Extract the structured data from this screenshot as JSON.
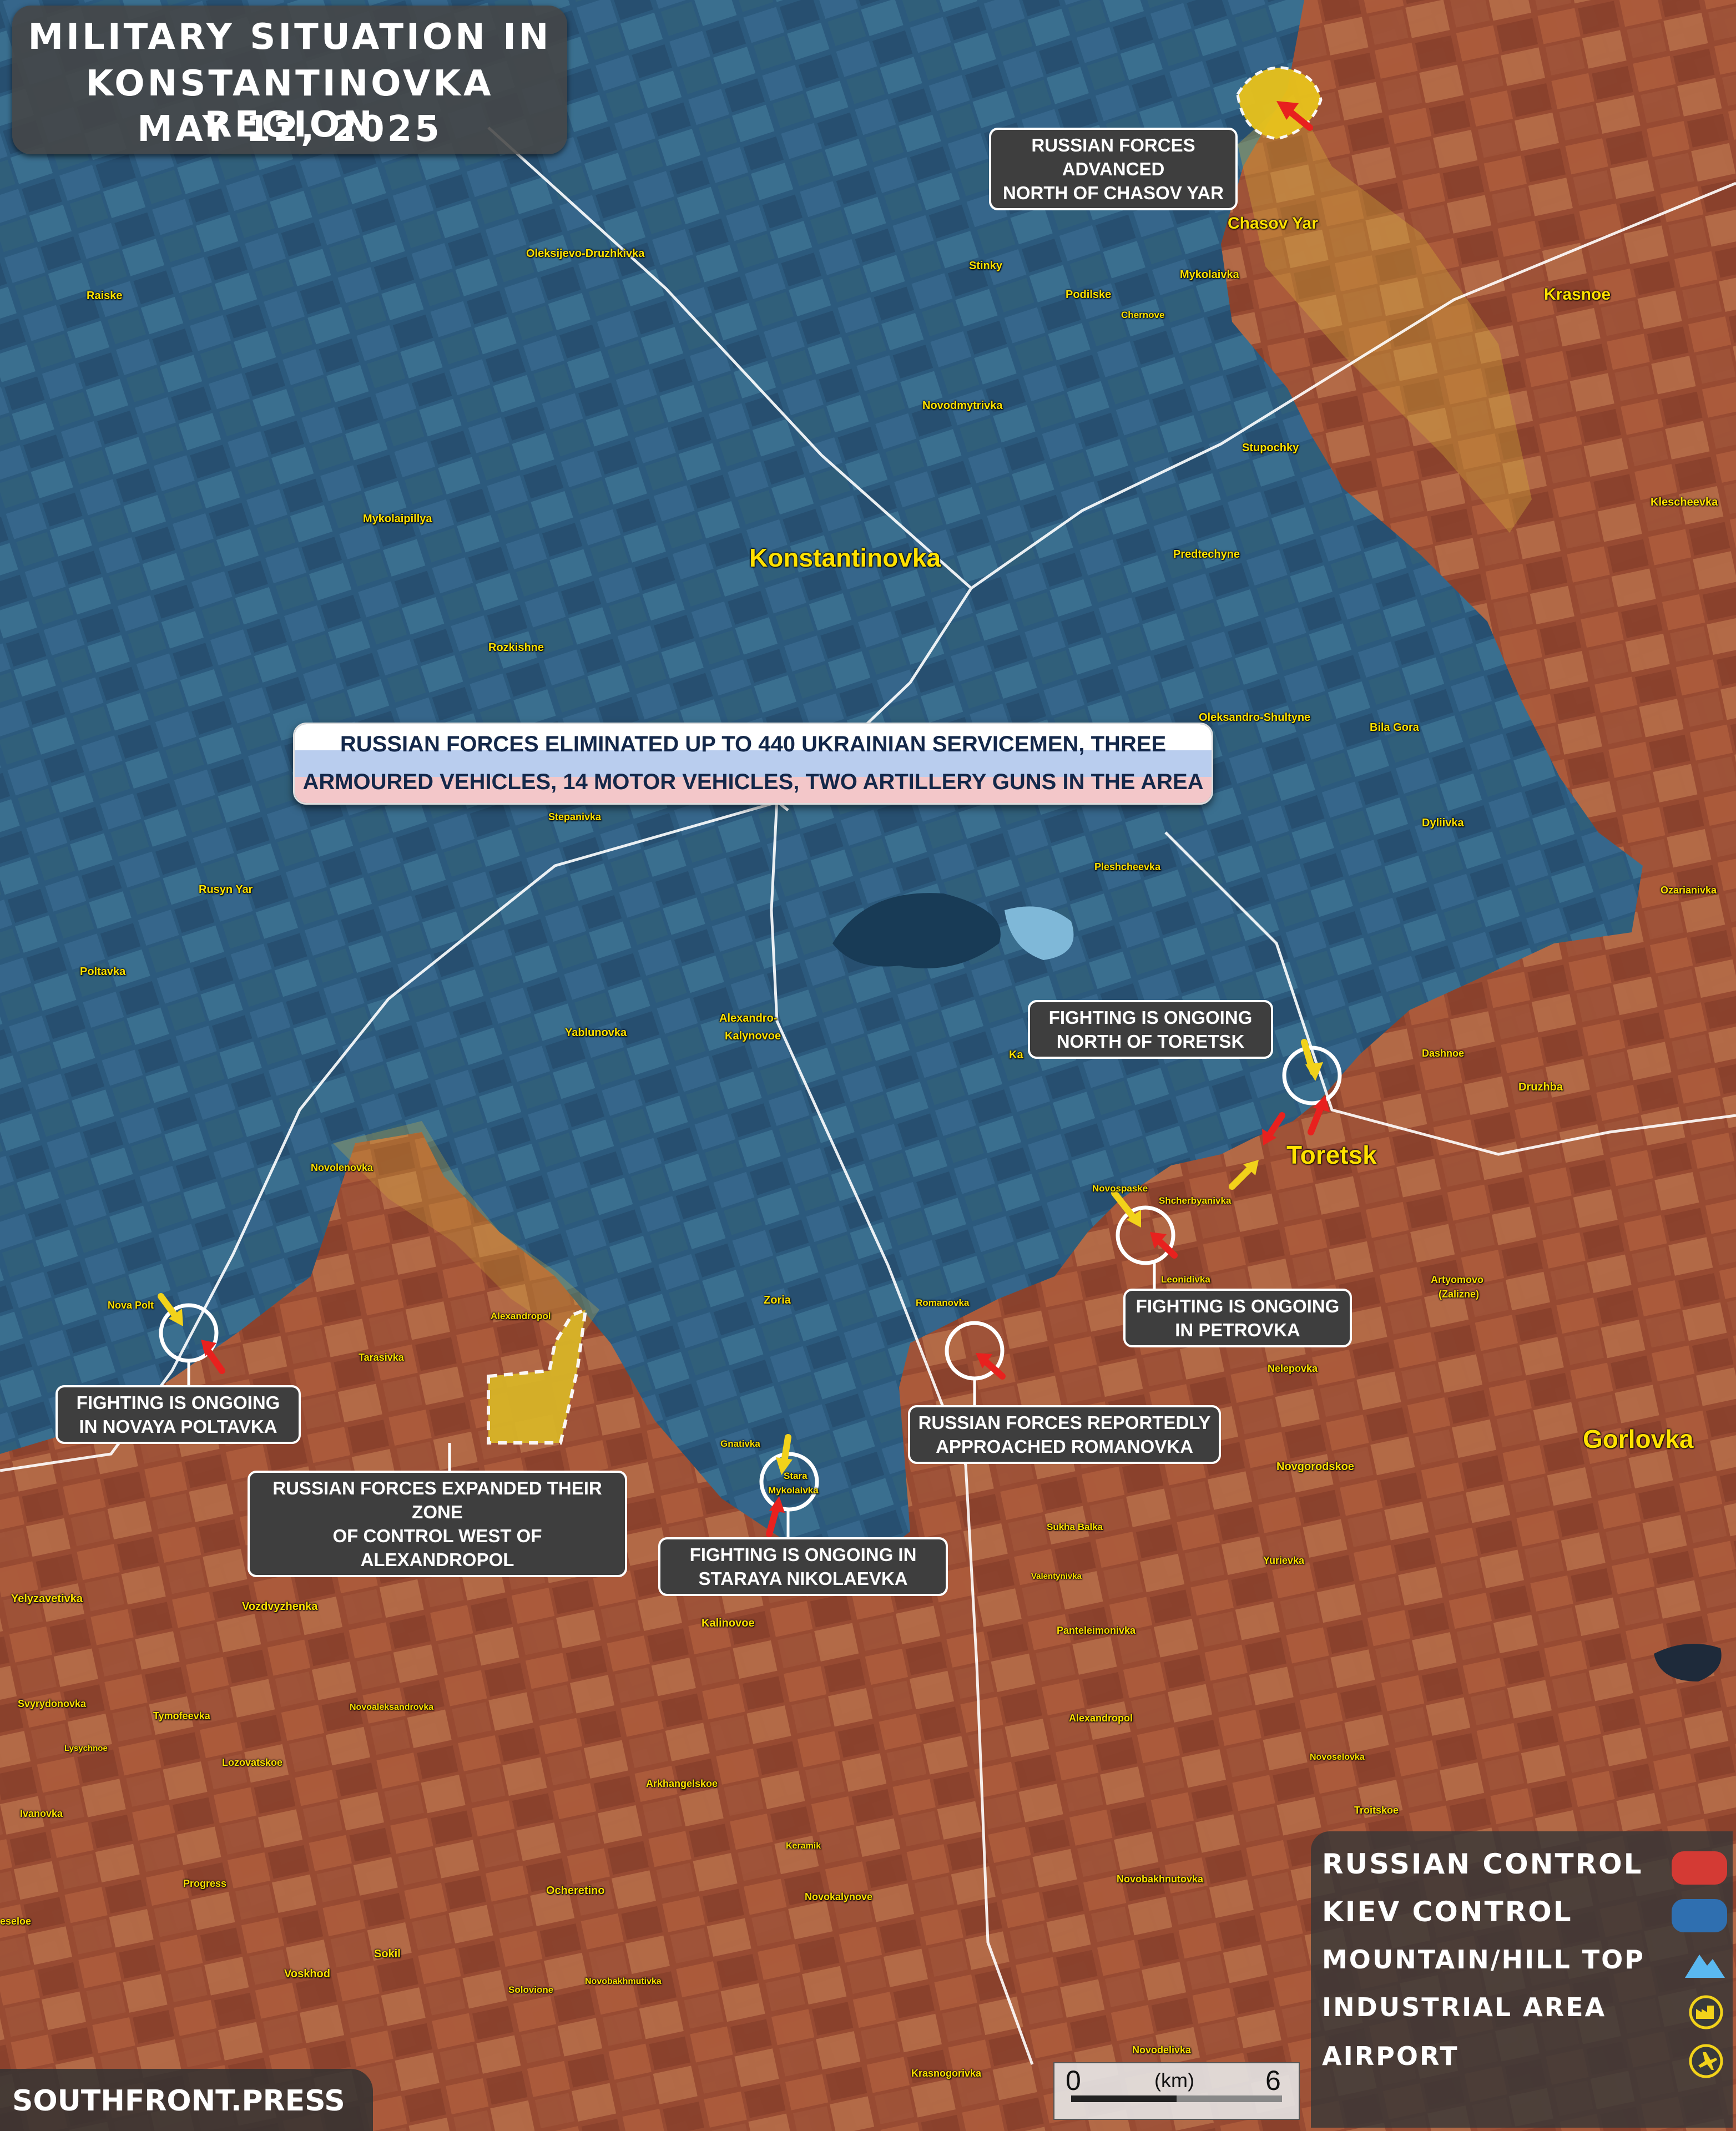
{
  "title": {
    "line1": "MILITARY SITUATION IN",
    "line2": "KONSTANTINOVKA REGION",
    "line3": "MAY 12, 2025"
  },
  "banner": {
    "line1": "RUSSIAN FORCES ELIMINATED UP TO 440 UKRAINIAN SERVICEMEN, THREE",
    "line2": "ARMOURED VEHICLES, 14 MOTOR VEHICLES, TWO ARTILLERY GUNS IN THE AREA"
  },
  "callouts": {
    "chasov_yar": [
      "RUSSIAN FORCES ADVANCED",
      "NORTH OF CHASOV YAR"
    ],
    "north_toretsk": [
      "FIGHTING IS ONGOING",
      "NORTH OF TORETSK"
    ],
    "petrovka": [
      "FIGHTING IS ONGOING",
      "IN PETROVKA"
    ],
    "romanovka": [
      "RUSSIAN FORCES REPORTEDLY",
      "APPROACHED ROMANOVKA"
    ],
    "staraya": [
      "FIGHTING IS ONGOING IN",
      "STARAYA NIKOLAEVKA"
    ],
    "alexandropol": [
      "RUSSIAN FORCES EXPANDED THEIR ZONE",
      "OF CONTROL WEST OF ALEXANDROPOL"
    ],
    "novaya_poltavka": [
      "FIGHTING IS ONGOING",
      "IN NOVAYA POLTAVKA"
    ]
  },
  "places": {
    "konstantinovka": "Konstantinovka",
    "chasov_yar": "Chasov Yar",
    "krasnoe": "Krasnoe",
    "toretsk": "Toretsk",
    "gorlovka": "Gorlovka",
    "oleksijevo": "Oleksijevo-Druzhkivka",
    "raiske": "Raiske",
    "stinky": "Stinky",
    "podilske": "Podilske",
    "mykolaivka": "Mykolaivka",
    "chernove": "Chernove",
    "novodmytrivka": "Novodmytrivka",
    "stupochky": "Stupochky",
    "klescheevka": "Klescheevka",
    "mykolaipillya": "Mykolaipillya",
    "predtechyne": "Predtechyne",
    "rozkishne": "Rozkishne",
    "oleksandro_shultyne": "Oleksandro-Shultyne",
    "bila_gora": "Bila Gora",
    "dyliivka": "Dyliivka",
    "stepanivka": "Stepanivka",
    "rusyn_yar": "Rusyn Yar",
    "pleshcheevka": "Pleshcheevka",
    "ozarianivka": "Ozarianivka",
    "poltavka": "Poltavka",
    "yablunovka": "Yablunovka",
    "alexandro_kalynovoe_1": "Alexandro-",
    "alexandro_kalynovoe_2": "Kalynovoe",
    "ka": "Ka",
    "dashnoe": "Dashnoe",
    "druzhba": "Druzhba",
    "novolenovka": "Novolenovka",
    "novospaske": "Novospaske",
    "shcherbyanivka": "Shcherbyanivka",
    "leonidivka": "Leonidivka",
    "artyomovo_1": "Artyomovo",
    "artyomovo_2": "(Zalizne)",
    "nova_poltavka_label": "Nova Polt",
    "alexandropol": "Alexandropol",
    "tarasivka": "Tarasivka",
    "zoria": "Zoria",
    "romanovka": "Romanovka",
    "nelepovka": "Nelepovka",
    "novgorodskoe": "Novgorodskoe",
    "gnativka": "Gnativka",
    "stara_1": "Stara",
    "stara_2": "Mykolaivka",
    "sukha_balka": "Sukha Balka",
    "valentynivka": "Valentynivka",
    "yurievka": "Yurievka",
    "yelyzavetivka": "Yelyzavetivka",
    "vozdvyzhenka": "Vozdvyzhenka",
    "kalinovoe": "Kalinovoe",
    "panteleimonivka": "Panteleimonivka",
    "svyrydonovka": "Svyrydonovka",
    "tymofeevka": "Tymofeevka",
    "novoaleksandrovka": "Novoaleksandrovka",
    "alexandropol_s": "Alexandropol",
    "lysychnoe": "Lysychnoe",
    "lozovatskoe": "Lozovatskoe",
    "novoselovka": "Novoselovka",
    "ivanovka": "Ivanovka",
    "arkhangelskoe": "Arkhangelskoe",
    "troitskoe": "Troitskoe",
    "keramik": "Keramik",
    "progress": "Progress",
    "ocheretino": "Ocheretino",
    "novokalynove": "Novokalynove",
    "novobakhnutovka": "Novobakhnutovka",
    "eseloe": "eseloe",
    "sokil": "Sokil",
    "voskhod": "Voskhod",
    "solovione": "Solovione",
    "novobakhmutivka": "Novobakhmutivka",
    "novodelivka": "Novodelivka",
    "krasnogorivka": "Krasnogorivka"
  },
  "legend": {
    "russian": {
      "label": "RUSSIAN CONTROL",
      "color": "#d43a34"
    },
    "kiev": {
      "label": "KIEV CONTROL",
      "color": "#2f6fb0"
    },
    "mountain": {
      "label": "MOUNTAIN/HILL TOP",
      "icon": "mountain-icon"
    },
    "industrial": {
      "label": "INDUSTRIAL AREA",
      "icon": "industrial-icon"
    },
    "airport": {
      "label": "AIRPORT",
      "icon": "airport-icon"
    }
  },
  "footer": {
    "site": "SOUTHFRONT.PRESS"
  },
  "scale": {
    "start": "0",
    "unit": "(km)",
    "end": "6"
  },
  "colors": {
    "kiev_area": "#2f5f85",
    "russian_area": "#a04a2e",
    "contested": "#d8b23a",
    "arrow_red": "#e8211e",
    "arrow_yellow": "#f2d21a",
    "label_yellow": "#ffe100"
  }
}
